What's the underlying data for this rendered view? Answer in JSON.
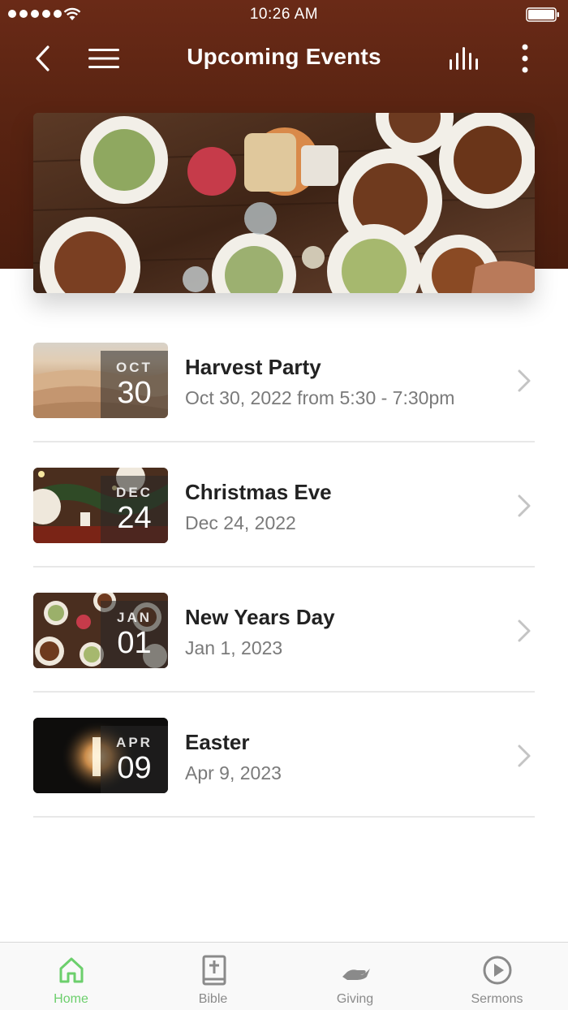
{
  "status_bar": {
    "time": "10:26 AM"
  },
  "nav": {
    "title": "Upcoming Events",
    "back_icon": "chevron-left-icon",
    "menu_icon": "hamburger-menu-icon",
    "stats_icon": "bar-chart-icon",
    "more_icon": "more-vertical-icon"
  },
  "hero": {
    "image": "food-table-overhead"
  },
  "events": [
    {
      "title": "Harvest Party",
      "date_text": "Oct 30, 2022 from 5:30 - 7:30pm",
      "month": "OCT",
      "day": "30",
      "thumb": "desert-dunes"
    },
    {
      "title": "Christmas Eve",
      "date_text": "Dec 24, 2022",
      "month": "DEC",
      "day": "24",
      "thumb": "christmas-table"
    },
    {
      "title": "New Years Day",
      "date_text": "Jan 1, 2023",
      "month": "JAN",
      "day": "01",
      "thumb": "dinner-table"
    },
    {
      "title": "Easter",
      "date_text": "Apr 9, 2023",
      "month": "APR",
      "day": "09",
      "thumb": "empty-tomb"
    }
  ],
  "tabs": [
    {
      "label": "Home",
      "icon": "home-icon",
      "active": true
    },
    {
      "label": "Bible",
      "icon": "bible-icon",
      "active": false
    },
    {
      "label": "Giving",
      "icon": "giving-hand-icon",
      "active": false
    },
    {
      "label": "Sermons",
      "icon": "play-circle-icon",
      "active": false
    }
  ],
  "colors": {
    "header_brown": "#5a2412",
    "active_tab": "#6ccf6c",
    "inactive_tab": "#8a8a8a"
  }
}
